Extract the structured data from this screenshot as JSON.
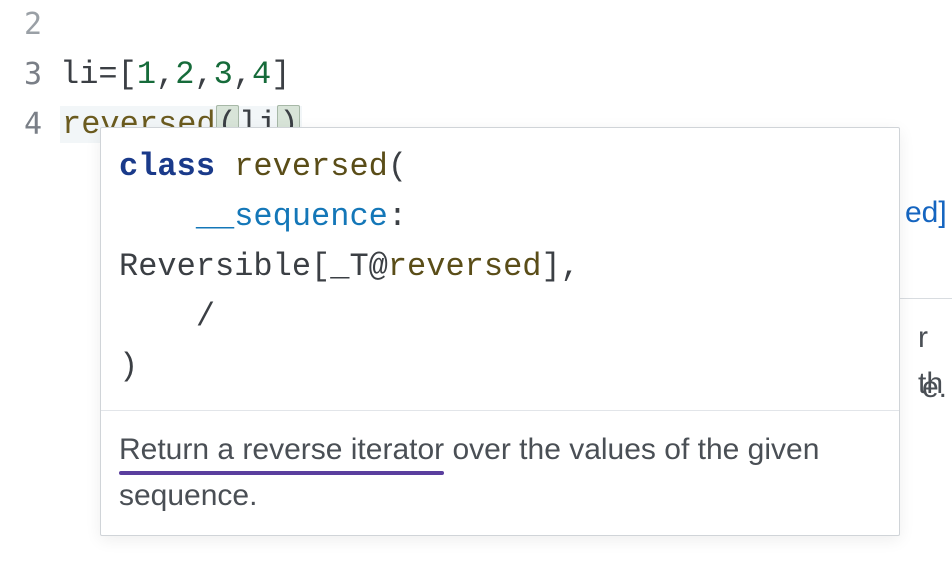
{
  "lines": {
    "n2": "2",
    "n3": "3",
    "n4": "4",
    "l3": {
      "var": "li",
      "eq": "=",
      "lb": "[",
      "v1": "1",
      "c": ",",
      "v2": "2",
      "v3": "3",
      "v4": "4",
      "rb": "]"
    },
    "l4": {
      "fn": "reversed",
      "lp": "(",
      "arg": "li",
      "rp": ")"
    }
  },
  "tooltip": {
    "sig": {
      "kw_class": "class",
      "name": "reversed",
      "lp": "(",
      "param_pre": "__",
      "param": "sequence",
      "colon": ":",
      "type_head": "Reversible[_T",
      "at": "@",
      "type_fn": "reversed",
      "type_tail": "],",
      "slash": "/",
      "rp": ")"
    },
    "doc": {
      "underlined": "Return a reverse iterator",
      "rest": " over the values of the given sequence."
    }
  },
  "behind": {
    "ed": "ed",
    "ed_bracket": "]",
    "rth": "r th",
    "dot": "e."
  }
}
